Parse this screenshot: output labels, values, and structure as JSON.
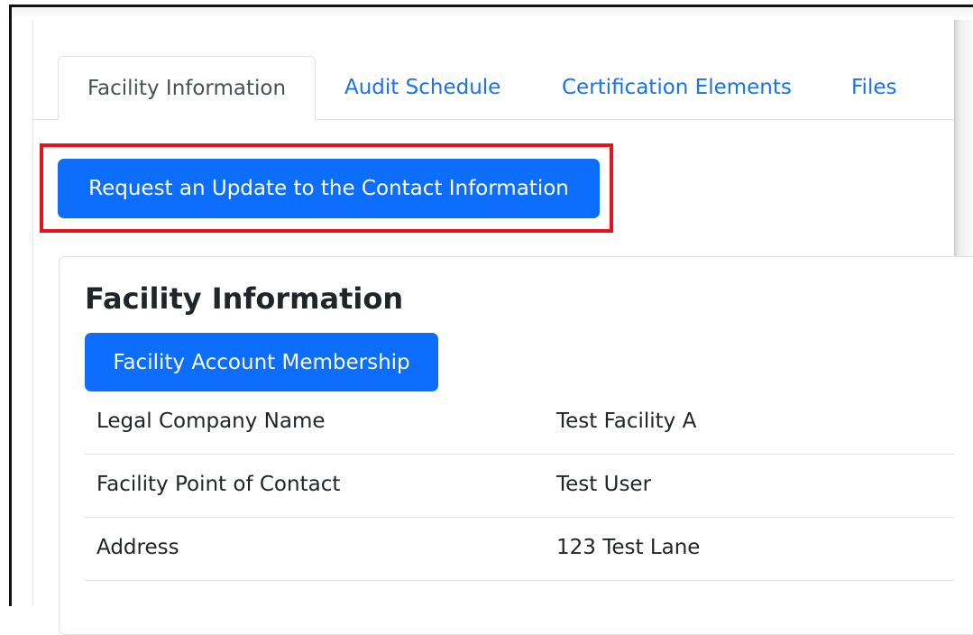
{
  "tabs": [
    {
      "label": "Facility Information",
      "active": true
    },
    {
      "label": "Audit Schedule",
      "active": false
    },
    {
      "label": "Certification Elements",
      "active": false
    },
    {
      "label": "Files",
      "active": false
    }
  ],
  "request_button_label": "Request an Update to the Contact Information",
  "card": {
    "title": "Facility Information",
    "membership_button_label": "Facility Account Membership",
    "rows": [
      {
        "label": "Legal Company Name",
        "value": "Test Facility A"
      },
      {
        "label": "Facility Point of Contact",
        "value": "Test User"
      },
      {
        "label": "Address",
        "value": "123 Test Lane"
      }
    ]
  },
  "colors": {
    "primary": "#0d6efd",
    "link": "#1a73e8",
    "highlight": "#e8141b"
  }
}
